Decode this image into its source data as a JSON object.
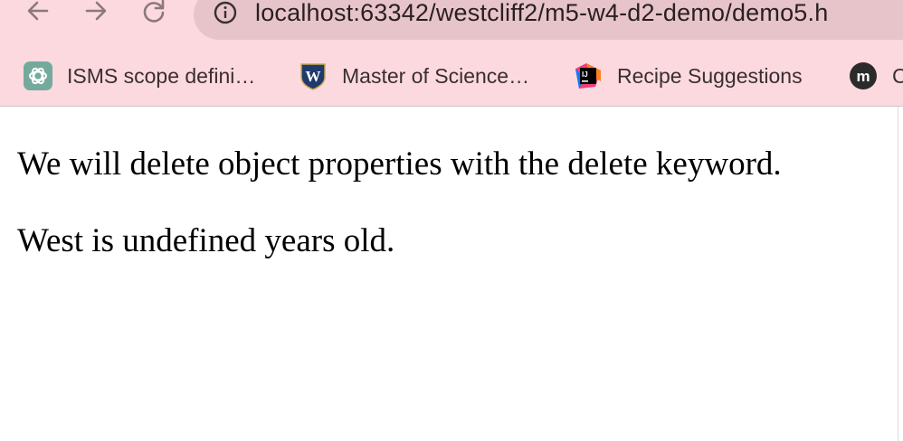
{
  "browser": {
    "url": "localhost:63342/westcliff2/m5-w4-d2-demo/demo5.h",
    "nav": {
      "back_icon": "arrow-left-icon",
      "forward_icon": "arrow-right-icon",
      "reload_icon": "reload-icon",
      "info_icon": "info-icon"
    },
    "bookmarks": [
      {
        "label": "ISMS scope defini…",
        "icon": "chatgpt-icon"
      },
      {
        "label": "Master of Science…",
        "icon": "westcliff-shield-icon"
      },
      {
        "label": "Recipe Suggestions",
        "icon": "jetbrains-icon"
      },
      {
        "label": "C",
        "icon": "m-logo-icon"
      }
    ],
    "colors": {
      "toolbar_bg": "#fcd9df",
      "omnibox_bg": "#e6c4ca"
    }
  },
  "page": {
    "paragraphs": [
      "We will delete object properties with the delete keyword.",
      "West is undefined years old."
    ]
  }
}
